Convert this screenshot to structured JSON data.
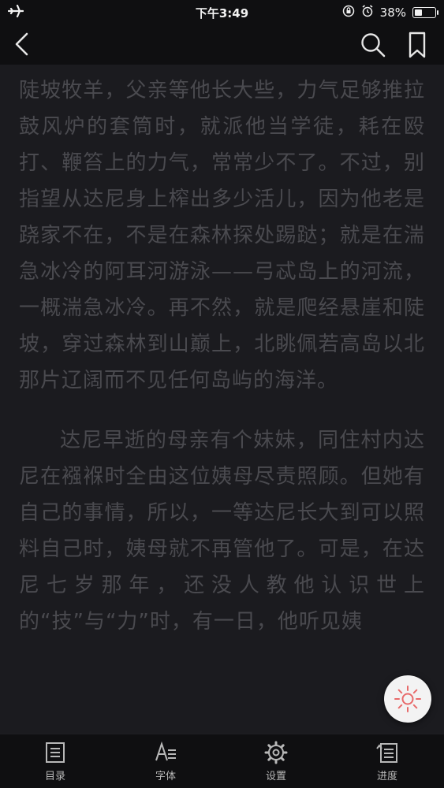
{
  "status_bar": {
    "time": "下午3:49",
    "battery": "38%",
    "battery_level": 0.38
  },
  "top_bar": {
    "back_icon": "chevron-left-icon",
    "search_icon": "search-icon",
    "bookmark_icon": "bookmark-icon"
  },
  "content": {
    "paragraph1": "陡坡牧羊，父亲等他长大些，力气足够推拉鼓风炉的套筒时，就派他当学徒，耗在殴打、鞭笞上的力气，常常少不了。不过，别指望从达尼身上榨出多少活儿，因为他老是跷家不在，不是在森林探处踢跶；就是在湍急冰冷的阿耳河游泳——弓忒岛上的河流，一概湍急冰冷。再不然，就是爬经悬崖和陡坡，穿过森林到山巅上，北眺佩若高岛以北那片辽阔而不见任何岛屿的海洋。",
    "paragraph2": "达尼早逝的母亲有个妹妹，同住村内达尼在襁褓时全由这位姨母尽责照顾。但她有自己的事情，所以，一等达尼长大到可以照料自己时，姨母就不再管他了。可是，在达尼七岁那年，还没人教他认识世上的“技”与“力”时，有一日，他听见姨"
  },
  "floating_button": {
    "icon": "brightness-icon",
    "color": "#e86a6a"
  },
  "bottom_bar": {
    "tabs": [
      {
        "label": "目录",
        "icon": "toc-icon"
      },
      {
        "label": "字体",
        "icon": "font-icon"
      },
      {
        "label": "设置",
        "icon": "gear-icon"
      },
      {
        "label": "进度",
        "icon": "progress-icon"
      }
    ]
  }
}
